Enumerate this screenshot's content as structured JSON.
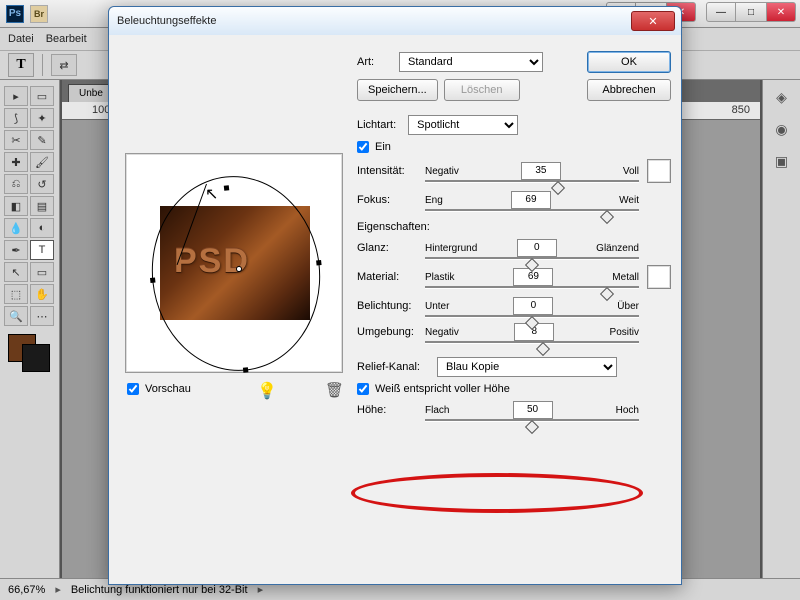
{
  "app": {
    "menu_file": "Datei",
    "menu_edit": "Bearbeit"
  },
  "win": {
    "close": "✕",
    "max": "□",
    "min": "—"
  },
  "tab": "Unbe",
  "ruler": {
    "a": "100",
    "b": "850"
  },
  "status": {
    "zoom": "66,67%",
    "msg": "Belichtung funktioniert nur bei 32-Bit"
  },
  "dlg": {
    "title": "Beleuchtungseffekte",
    "art_label": "Art:",
    "art_value": "Standard",
    "ok": "OK",
    "cancel": "Abbrechen",
    "save": "Speichern...",
    "delete": "Löschen",
    "lichtart_label": "Lichtart:",
    "lichtart_value": "Spotlicht",
    "ein": "Ein",
    "vorschau": "Vorschau",
    "eigenschaften": "Eigenschaften:",
    "intensitaet": {
      "label": "Intensität:",
      "l": "Negativ",
      "r": "Voll",
      "v": "35",
      "pos": 62
    },
    "fokus": {
      "label": "Fokus:",
      "l": "Eng",
      "r": "Weit",
      "v": "69",
      "pos": 85
    },
    "glanz": {
      "label": "Glanz:",
      "l": "Hintergrund",
      "r": "Glänzend",
      "v": "0",
      "pos": 50
    },
    "material": {
      "label": "Material:",
      "l": "Plastik",
      "r": "Metall",
      "v": "69",
      "pos": 85
    },
    "belichtung": {
      "label": "Belichtung:",
      "l": "Unter",
      "r": "Über",
      "v": "0",
      "pos": 50
    },
    "umgebung": {
      "label": "Umgebung:",
      "l": "Negativ",
      "r": "Positiv",
      "v": "8",
      "pos": 55
    },
    "relief_label": "Relief-Kanal:",
    "relief_value": "Blau Kopie",
    "weiss": "Weiß entspricht voller Höhe",
    "hoehe": {
      "label": "Höhe:",
      "l": "Flach",
      "r": "Hoch",
      "v": "50",
      "pos": 50
    }
  },
  "preview_text": "PSD"
}
